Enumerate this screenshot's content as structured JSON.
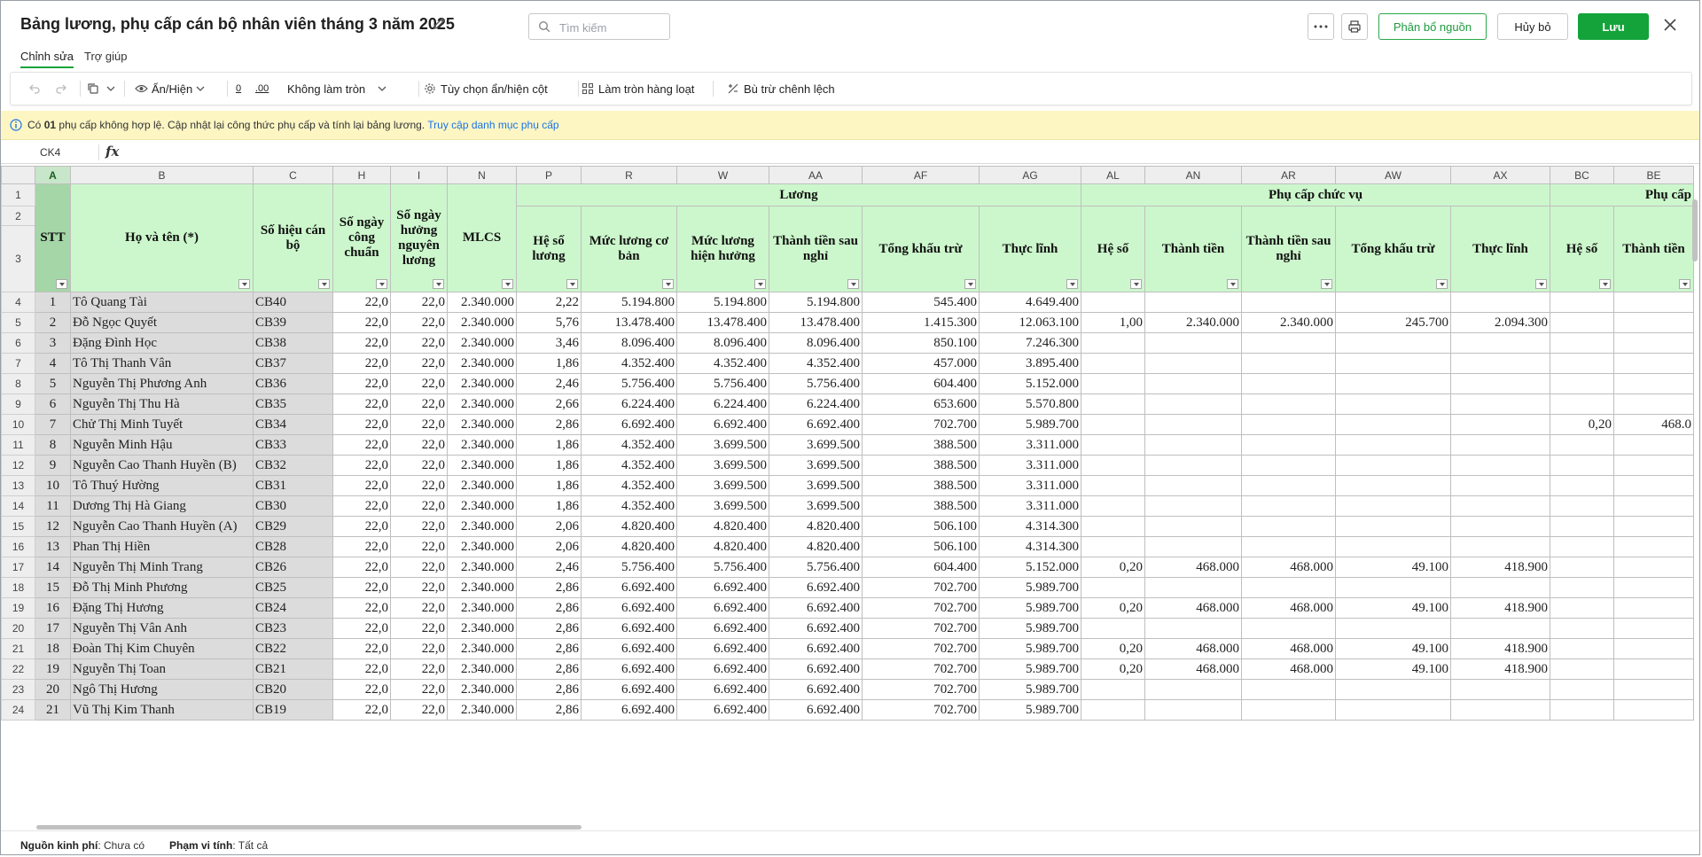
{
  "title": "Bảng lương, phụ cấp cán bộ nhân viên tháng 3 năm 2025",
  "search": {
    "placeholder": "Tìm kiếm"
  },
  "buttons": {
    "allocate": "Phân bổ nguồn",
    "cancel": "Hủy bỏ",
    "save": "Lưu"
  },
  "tabs": [
    "Chỉnh sửa",
    "Trợ giúp"
  ],
  "toolbar": {
    "show_hide": "Ẩn/Hiện",
    "dec0": "0",
    "dec00": ".00",
    "rounding": "Không làm tròn",
    "column_options": "Tùy chọn ẩn/hiện cột",
    "bulk_round": "Làm tròn hàng loạt",
    "offset": "Bù trừ chênh lệch"
  },
  "warning": {
    "prefix": "Có",
    "count": "01",
    "text": "phụ cấp không hợp lệ. Cập nhật lại công thức phụ cấp và tính lại bảng lương.",
    "link": "Truy cập danh mục phụ cấp"
  },
  "formula_bar": {
    "cell_ref": "CK4",
    "fx": "fx"
  },
  "columns": [
    "A",
    "B",
    "C",
    "H",
    "I",
    "N",
    "P",
    "R",
    "W",
    "AA",
    "AF",
    "AG",
    "AL",
    "AN",
    "AR",
    "AW",
    "AX",
    "BC",
    "BE"
  ],
  "row_numbers": [
    "1",
    "2",
    "3"
  ],
  "group_headers": {
    "luong": "Lương",
    "phu_cap_chuc_vu": "Phụ cấp chức vụ",
    "phu_cap": "Phụ cấp"
  },
  "headers": [
    "STT",
    "Họ và tên (*)",
    "Số hiệu cán bộ",
    "Số ngày công chuẩn",
    "Số ngày hưởng nguyên lương",
    "MLCS",
    "Hệ số lương",
    "Mức lương cơ bản",
    "Mức lương hiện hưởng",
    "Thành tiền sau nghỉ",
    "Tổng khấu trừ",
    "Thực lĩnh",
    "Hệ số",
    "Thành tiền",
    "Thành tiền sau nghỉ",
    "Tổng khấu trừ",
    "Thực lĩnh",
    "Hệ số",
    "Thành tiền"
  ],
  "rows": [
    [
      "4",
      "1",
      "Tô Quang Tài",
      "CB40",
      "22,0",
      "22,0",
      "2.340.000",
      "2,22",
      "5.194.800",
      "5.194.800",
      "5.194.800",
      "545.400",
      "4.649.400",
      "",
      "",
      "",
      "",
      "",
      "",
      ""
    ],
    [
      "5",
      "2",
      "Đỗ Ngọc Quyết",
      "CB39",
      "22,0",
      "22,0",
      "2.340.000",
      "5,76",
      "13.478.400",
      "13.478.400",
      "13.478.400",
      "1.415.300",
      "12.063.100",
      "1,00",
      "2.340.000",
      "2.340.000",
      "245.700",
      "2.094.300",
      "",
      ""
    ],
    [
      "6",
      "3",
      "Đặng Đình Học",
      "CB38",
      "22,0",
      "22,0",
      "2.340.000",
      "3,46",
      "8.096.400",
      "8.096.400",
      "8.096.400",
      "850.100",
      "7.246.300",
      "",
      "",
      "",
      "",
      "",
      "",
      ""
    ],
    [
      "7",
      "4",
      "Tô Thị Thanh Vân",
      "CB37",
      "22,0",
      "22,0",
      "2.340.000",
      "1,86",
      "4.352.400",
      "4.352.400",
      "4.352.400",
      "457.000",
      "3.895.400",
      "",
      "",
      "",
      "",
      "",
      "",
      ""
    ],
    [
      "8",
      "5",
      "Nguyễn Thị Phương Anh",
      "CB36",
      "22,0",
      "22,0",
      "2.340.000",
      "2,46",
      "5.756.400",
      "5.756.400",
      "5.756.400",
      "604.400",
      "5.152.000",
      "",
      "",
      "",
      "",
      "",
      "",
      ""
    ],
    [
      "9",
      "6",
      "Nguyễn Thị Thu Hà",
      "CB35",
      "22,0",
      "22,0",
      "2.340.000",
      "2,66",
      "6.224.400",
      "6.224.400",
      "6.224.400",
      "653.600",
      "5.570.800",
      "",
      "",
      "",
      "",
      "",
      "",
      ""
    ],
    [
      "10",
      "7",
      "Chử Thị Minh Tuyết",
      "CB34",
      "22,0",
      "22,0",
      "2.340.000",
      "2,86",
      "6.692.400",
      "6.692.400",
      "6.692.400",
      "702.700",
      "5.989.700",
      "",
      "",
      "",
      "",
      "",
      "0,20",
      "468.0"
    ],
    [
      "11",
      "8",
      "Nguyễn Minh Hậu",
      "CB33",
      "22,0",
      "22,0",
      "2.340.000",
      "1,86",
      "4.352.400",
      "3.699.500",
      "3.699.500",
      "388.500",
      "3.311.000",
      "",
      "",
      "",
      "",
      "",
      "",
      ""
    ],
    [
      "12",
      "9",
      "Nguyễn Cao Thanh Huyền  (B)",
      "CB32",
      "22,0",
      "22,0",
      "2.340.000",
      "1,86",
      "4.352.400",
      "3.699.500",
      "3.699.500",
      "388.500",
      "3.311.000",
      "",
      "",
      "",
      "",
      "",
      "",
      ""
    ],
    [
      "13",
      "10",
      "Tô Thuý Hường",
      "CB31",
      "22,0",
      "22,0",
      "2.340.000",
      "1,86",
      "4.352.400",
      "3.699.500",
      "3.699.500",
      "388.500",
      "3.311.000",
      "",
      "",
      "",
      "",
      "",
      "",
      ""
    ],
    [
      "14",
      "11",
      "Dương Thị Hà Giang",
      "CB30",
      "22,0",
      "22,0",
      "2.340.000",
      "1,86",
      "4.352.400",
      "3.699.500",
      "3.699.500",
      "388.500",
      "3.311.000",
      "",
      "",
      "",
      "",
      "",
      "",
      ""
    ],
    [
      "15",
      "12",
      "Nguyễn Cao Thanh Huyền  (A)",
      "CB29",
      "22,0",
      "22,0",
      "2.340.000",
      "2,06",
      "4.820.400",
      "4.820.400",
      "4.820.400",
      "506.100",
      "4.314.300",
      "",
      "",
      "",
      "",
      "",
      "",
      ""
    ],
    [
      "16",
      "13",
      "Phan Thị Hiền",
      "CB28",
      "22,0",
      "22,0",
      "2.340.000",
      "2,06",
      "4.820.400",
      "4.820.400",
      "4.820.400",
      "506.100",
      "4.314.300",
      "",
      "",
      "",
      "",
      "",
      "",
      ""
    ],
    [
      "17",
      "14",
      "Nguyễn Thị Minh Trang",
      "CB26",
      "22,0",
      "22,0",
      "2.340.000",
      "2,46",
      "5.756.400",
      "5.756.400",
      "5.756.400",
      "604.400",
      "5.152.000",
      "0,20",
      "468.000",
      "468.000",
      "49.100",
      "418.900",
      "",
      ""
    ],
    [
      "18",
      "15",
      "Đỗ Thị Minh Phương",
      "CB25",
      "22,0",
      "22,0",
      "2.340.000",
      "2,86",
      "6.692.400",
      "6.692.400",
      "6.692.400",
      "702.700",
      "5.989.700",
      "",
      "",
      "",
      "",
      "",
      "",
      ""
    ],
    [
      "19",
      "16",
      "Đặng Thị Hương",
      "CB24",
      "22,0",
      "22,0",
      "2.340.000",
      "2,86",
      "6.692.400",
      "6.692.400",
      "6.692.400",
      "702.700",
      "5.989.700",
      "0,20",
      "468.000",
      "468.000",
      "49.100",
      "418.900",
      "",
      ""
    ],
    [
      "20",
      "17",
      "Nguyễn Thị Vân Anh",
      "CB23",
      "22,0",
      "22,0",
      "2.340.000",
      "2,86",
      "6.692.400",
      "6.692.400",
      "6.692.400",
      "702.700",
      "5.989.700",
      "",
      "",
      "",
      "",
      "",
      "",
      ""
    ],
    [
      "21",
      "18",
      "Đoàn Thị Kim Chuyên",
      "CB22",
      "22,0",
      "22,0",
      "2.340.000",
      "2,86",
      "6.692.400",
      "6.692.400",
      "6.692.400",
      "702.700",
      "5.989.700",
      "0,20",
      "468.000",
      "468.000",
      "49.100",
      "418.900",
      "",
      ""
    ],
    [
      "22",
      "19",
      "Nguyễn Thị Toan",
      "CB21",
      "22,0",
      "22,0",
      "2.340.000",
      "2,86",
      "6.692.400",
      "6.692.400",
      "6.692.400",
      "702.700",
      "5.989.700",
      "0,20",
      "468.000",
      "468.000",
      "49.100",
      "418.900",
      "",
      ""
    ],
    [
      "23",
      "20",
      "Ngô Thị Hương",
      "CB20",
      "22,0",
      "22,0",
      "2.340.000",
      "2,86",
      "6.692.400",
      "6.692.400",
      "6.692.400",
      "702.700",
      "5.989.700",
      "",
      "",
      "",
      "",
      "",
      "",
      ""
    ],
    [
      "24",
      "21",
      "Vũ Thị Kim Thanh",
      "CB19",
      "22,0",
      "22,0",
      "2.340.000",
      "2,86",
      "6.692.400",
      "6.692.400",
      "6.692.400",
      "702.700",
      "5.989.700",
      "",
      "",
      "",
      "",
      "",
      "",
      ""
    ]
  ],
  "footer": {
    "source_label": "Nguồn kinh phí",
    "source_value": "Chưa có",
    "scope_label": "Phạm vi tính",
    "scope_value": "Tất cả"
  }
}
